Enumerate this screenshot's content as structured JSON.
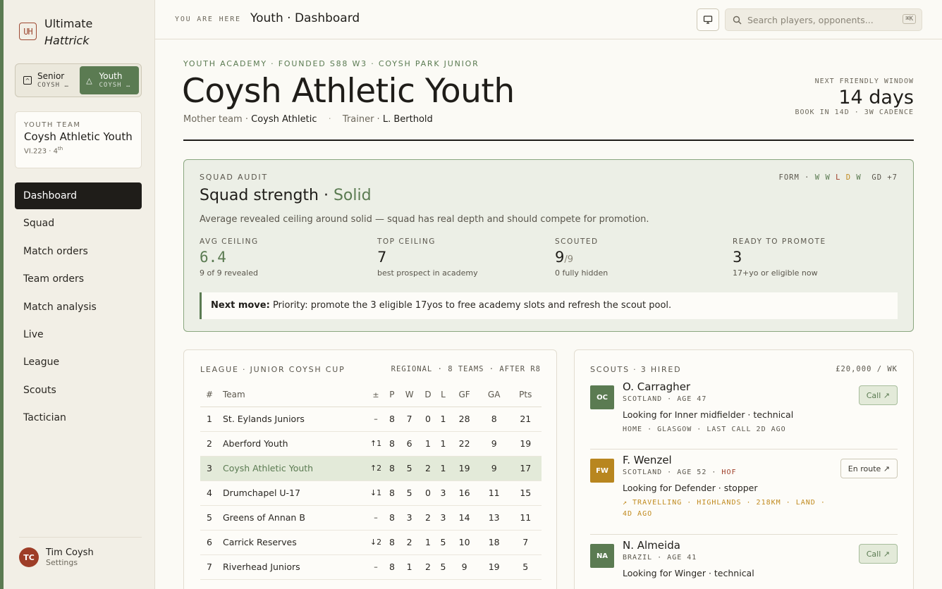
{
  "brand": {
    "logo": "UH",
    "line1": "Ultimate",
    "line2": "Hattrick"
  },
  "switcher": [
    {
      "title": "Senior",
      "sub": "COYSH …",
      "icon": "shield-icon",
      "active": false
    },
    {
      "title": "Youth",
      "sub": "COYSH …",
      "icon": "triangle-icon",
      "active": true
    }
  ],
  "team_card": {
    "label": "YOUTH TEAM",
    "name": "Coysh Athletic Youth",
    "meta_prefix": "VI.223 · 4",
    "meta_sup": "th"
  },
  "nav": [
    "Dashboard",
    "Squad",
    "Match orders",
    "Team orders",
    "Match analysis",
    "Live",
    "League",
    "Scouts",
    "Tactician"
  ],
  "nav_active": "Dashboard",
  "user": {
    "initials": "TC",
    "name": "Tim Coysh",
    "settings": "Settings"
  },
  "topbar": {
    "crumb_label": "YOU ARE HERE",
    "crumb_value": "Youth · Dashboard",
    "search_placeholder": "Search players, opponents...",
    "search_kbd": "⌘K"
  },
  "header": {
    "eyebrow": "YOUTH ACADEMY · FOUNDED S88 W3 · COYSH PARK JUNIOR",
    "title": "Coysh Athletic Youth",
    "mother_label": "Mother team ·",
    "mother_value": "Coysh Athletic",
    "trainer_label": "Trainer ·",
    "trainer_value": "L. Berthold",
    "next_label": "NEXT FRIENDLY WINDOW",
    "next_value": "14 days",
    "next_sub": "BOOK IN 14D · 3W CADENCE"
  },
  "audit": {
    "label": "SQUAD AUDIT",
    "title_prefix": "Squad strength ·",
    "title_rating": "Solid",
    "form_label": "FORM ·",
    "form": [
      "W",
      "W",
      "L",
      "D",
      "W"
    ],
    "gd": "GD +7",
    "desc": "Average revealed ceiling around solid — squad has real depth and should compete for promotion.",
    "stats": [
      {
        "label": "AVG CEILING",
        "value": "6.4",
        "suffix": "",
        "sub": "9 of 9 revealed"
      },
      {
        "label": "TOP CEILING",
        "value": "7",
        "suffix": "",
        "sub": "best prospect in academy"
      },
      {
        "label": "SCOUTED",
        "value": "9",
        "suffix": "/9",
        "sub": "0 fully hidden"
      },
      {
        "label": "READY TO PROMOTE",
        "value": "3",
        "suffix": "",
        "sub": "17+yo or eligible now"
      }
    ],
    "next_move_label": "Next move:",
    "next_move_text": "Priority: promote the 3 eligible 17yos to free academy slots and refresh the scout pool."
  },
  "league": {
    "label": "LEAGUE · JUNIOR COYSH CUP",
    "right": "REGIONAL · 8 TEAMS · AFTER R8",
    "columns": [
      "#",
      "Team",
      "±",
      "P",
      "W",
      "D",
      "L",
      "GF",
      "GA",
      "Pts"
    ],
    "rows": [
      {
        "rank": "1",
        "team": "St. Eylands Juniors",
        "mv": "–",
        "dir": "flat",
        "p": "8",
        "w": "7",
        "d": "0",
        "l": "1",
        "gf": "28",
        "ga": "8",
        "pts": "21"
      },
      {
        "rank": "2",
        "team": "Aberford Youth",
        "mv": "↑1",
        "dir": "up",
        "p": "8",
        "w": "6",
        "d": "1",
        "l": "1",
        "gf": "22",
        "ga": "9",
        "pts": "19"
      },
      {
        "rank": "3",
        "team": "Coysh Athletic Youth",
        "mv": "↑2",
        "dir": "up",
        "p": "8",
        "w": "5",
        "d": "2",
        "l": "1",
        "gf": "19",
        "ga": "9",
        "pts": "17",
        "highlight": true
      },
      {
        "rank": "4",
        "team": "Drumchapel U-17",
        "mv": "↓1",
        "dir": "down",
        "p": "8",
        "w": "5",
        "d": "0",
        "l": "3",
        "gf": "16",
        "ga": "11",
        "pts": "15"
      },
      {
        "rank": "5",
        "team": "Greens of Annan B",
        "mv": "–",
        "dir": "flat",
        "p": "8",
        "w": "3",
        "d": "2",
        "l": "3",
        "gf": "14",
        "ga": "13",
        "pts": "11"
      },
      {
        "rank": "6",
        "team": "Carrick Reserves",
        "mv": "↓2",
        "dir": "down",
        "p": "8",
        "w": "2",
        "d": "1",
        "l": "5",
        "gf": "10",
        "ga": "18",
        "pts": "7"
      },
      {
        "rank": "7",
        "team": "Riverhead Juniors",
        "mv": "–",
        "dir": "flat",
        "p": "8",
        "w": "1",
        "d": "2",
        "l": "5",
        "gf": "9",
        "ga": "19",
        "pts": "5"
      }
    ]
  },
  "scouts": {
    "label": "SCOUTS · 3 HIRED",
    "right": "£20,000 / WK",
    "list": [
      {
        "initials": "OC",
        "color": "#5b7b52",
        "name": "O. Carragher",
        "meta": "SCOTLAND · AGE 47",
        "hof": "",
        "looking": "Looking for Inner midfielder · technical",
        "status": "HOME · GLASGOW · LAST CALL 2D AGO",
        "travel": false,
        "button": "Call ↗",
        "btn_style": "call"
      },
      {
        "initials": "FW",
        "color": "#b8861f",
        "name": "F. Wenzel",
        "meta": "SCOTLAND · AGE 52 ·",
        "hof": "HOF",
        "looking": "Looking for Defender · stopper",
        "status": "↗ TRAVELLING · HIGHLANDS · 218KM · LAND · 4D AGO",
        "travel": true,
        "button": "En route ↗",
        "btn_style": "route"
      },
      {
        "initials": "NA",
        "color": "#5b7b52",
        "name": "N. Almeida",
        "meta": "BRAZIL · AGE 41",
        "hof": "",
        "looking": "Looking for Winger · technical",
        "status": "",
        "travel": false,
        "button": "Call ↗",
        "btn_style": "call"
      }
    ]
  },
  "colors": {
    "accent": "#5b7b52",
    "danger": "#9e3d27",
    "warning": "#c08a1e",
    "ink": "#1f1d19"
  }
}
